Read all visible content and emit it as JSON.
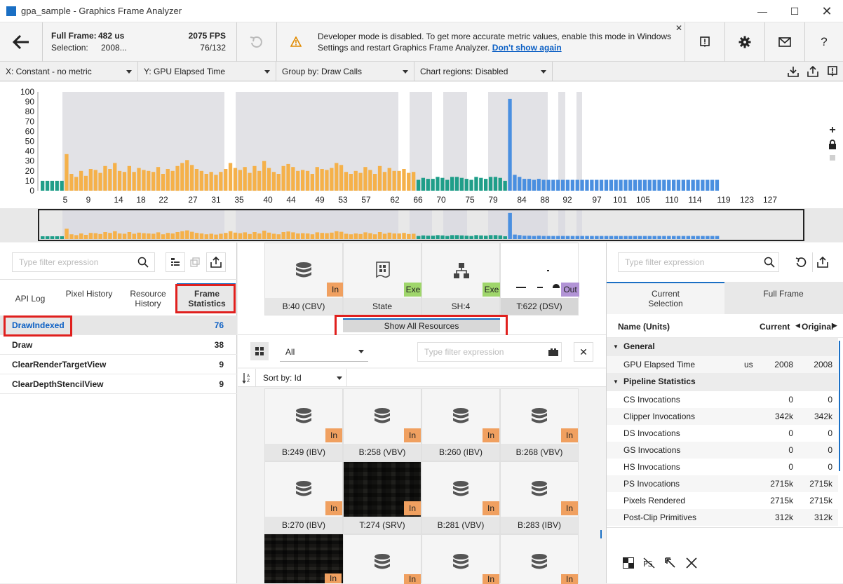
{
  "window": {
    "title": "gpa_sample - Graphics Frame Analyzer"
  },
  "topbar": {
    "full_frame_label": "Full Frame:",
    "full_frame_value": "482 us",
    "selection_label": "Selection:",
    "selection_value": "2008...",
    "fps": "2075 FPS",
    "frame_counter": "76/132",
    "notice_line1": "Developer mode is disabled. To get more accurate metric values, enable this mode in Windows",
    "notice_line2": "Settings and restart Graphics Frame Analyzer.",
    "notice_link": "Don't show again"
  },
  "dropdowns": {
    "x": "X: Constant - no metric",
    "y": "Y: GPU Elapsed Time",
    "group": "Group by: Draw Calls",
    "regions": "Chart regions: Disabled"
  },
  "chart_data": {
    "type": "bar",
    "ylim": [
      0,
      100
    ],
    "yticks": [
      "100",
      "90",
      "80",
      "70",
      "60",
      "50",
      "40",
      "30",
      "20",
      "10",
      "0"
    ],
    "xticks": [
      "5",
      "9",
      "14",
      "18",
      "22",
      "27",
      "31",
      "35",
      "40",
      "44",
      "49",
      "53",
      "57",
      "62",
      "66",
      "70",
      "75",
      "79",
      "84",
      "88",
      "92",
      "97",
      "101",
      "105",
      "110",
      "114",
      "119",
      "123",
      "127"
    ],
    "series": [
      {
        "color": "#1f9e89",
        "values": [
          10,
          10,
          10,
          10,
          10
        ]
      },
      {
        "color": "#f5b14a",
        "values": [
          37,
          17,
          14,
          20,
          15,
          22,
          21,
          18,
          25,
          22,
          28,
          20,
          19,
          25,
          19,
          23,
          21,
          20,
          19,
          24,
          17,
          22,
          20,
          25,
          28,
          31,
          26,
          22,
          20,
          17,
          19,
          16,
          19,
          22,
          28,
          23,
          21,
          24,
          18,
          25,
          20,
          30,
          23,
          19,
          17,
          25,
          27,
          24,
          20,
          21,
          20,
          17,
          24,
          22,
          21,
          23,
          28,
          26,
          19,
          17,
          20,
          18,
          24,
          21,
          17,
          25,
          19,
          23,
          20,
          20,
          22,
          18,
          19
        ]
      },
      {
        "color": "#1f9e89",
        "values": [
          11,
          13,
          12,
          12,
          14,
          13,
          11,
          14,
          14,
          13,
          12,
          11,
          14,
          13,
          12,
          14,
          14,
          13,
          10
        ]
      },
      {
        "color": "#4a8fe0",
        "values": [
          93,
          16,
          14,
          12,
          12,
          11,
          12,
          11,
          11,
          11,
          11,
          11,
          11,
          11,
          11,
          11,
          11,
          11,
          11,
          11,
          11,
          11,
          11,
          11,
          11,
          11,
          11,
          11,
          11,
          11,
          11,
          11,
          11,
          11,
          11,
          11,
          11,
          11,
          11,
          11,
          11,
          11,
          11,
          11
        ]
      }
    ]
  },
  "left_panel": {
    "filter_placeholder": "Type filter expression",
    "tabs": [
      "API Log",
      "Pixel History",
      "Resource History",
      "Frame Statistics"
    ],
    "rows": [
      {
        "name": "DrawIndexed",
        "count": "76"
      },
      {
        "name": "Draw",
        "count": "38"
      },
      {
        "name": "ClearRenderTargetView",
        "count": "9"
      },
      {
        "name": "ClearDepthStencilView",
        "count": "9"
      }
    ]
  },
  "center_panel": {
    "top_tiles": [
      {
        "label": "B:40 (CBV)",
        "badge": "In"
      },
      {
        "label": "State",
        "badge": "Exe"
      },
      {
        "label": "SH:4",
        "badge": "Exe"
      },
      {
        "label": "T:622 (DSV)",
        "badge": "Out"
      }
    ],
    "show_all_button": "Show All Resources",
    "filter_select": "All",
    "filter_placeholder": "Type filter expression",
    "sort_label": "Sort by: Id",
    "grid_row1": [
      {
        "label": "B:249 (IBV)",
        "badge": "In"
      },
      {
        "label": "B:258 (VBV)",
        "badge": "In"
      },
      {
        "label": "B:260 (IBV)",
        "badge": "In"
      },
      {
        "label": "B:268 (VBV)",
        "badge": "In"
      }
    ],
    "grid_row2": [
      {
        "label": "B:270 (IBV)",
        "badge": "In"
      },
      {
        "label": "T:274 (SRV)",
        "badge": "In"
      },
      {
        "label": "B:281 (VBV)",
        "badge": "In"
      },
      {
        "label": "B:283 (IBV)",
        "badge": "In"
      }
    ],
    "grid_row3_badge": "In"
  },
  "right_panel": {
    "filter_placeholder": "Type filter expression",
    "tab_current": "Current Selection",
    "tab_full": "Full Frame",
    "col_name": "Name (Units)",
    "col_current": "Current",
    "col_original": "Original",
    "section_general": "General",
    "gpu_row": {
      "name": "GPU Elapsed Time",
      "unit": "us",
      "current": "2008",
      "original": "2008"
    },
    "section_pipeline": "Pipeline Statistics",
    "pipeline_rows": [
      {
        "name": "CS Invocations",
        "current": "0",
        "original": "0"
      },
      {
        "name": "Clipper Invocations",
        "current": "342k",
        "original": "342k"
      },
      {
        "name": "DS Invocations",
        "current": "0",
        "original": "0"
      },
      {
        "name": "GS Invocations",
        "current": "0",
        "original": "0"
      },
      {
        "name": "HS Invocations",
        "current": "0",
        "original": "0"
      },
      {
        "name": "PS Invocations",
        "current": "2715k",
        "original": "2715k"
      },
      {
        "name": "Pixels Rendered",
        "current": "2715k",
        "original": "2715k"
      },
      {
        "name": "Post-Clip Primitives",
        "current": "312k",
        "original": "312k"
      }
    ]
  }
}
